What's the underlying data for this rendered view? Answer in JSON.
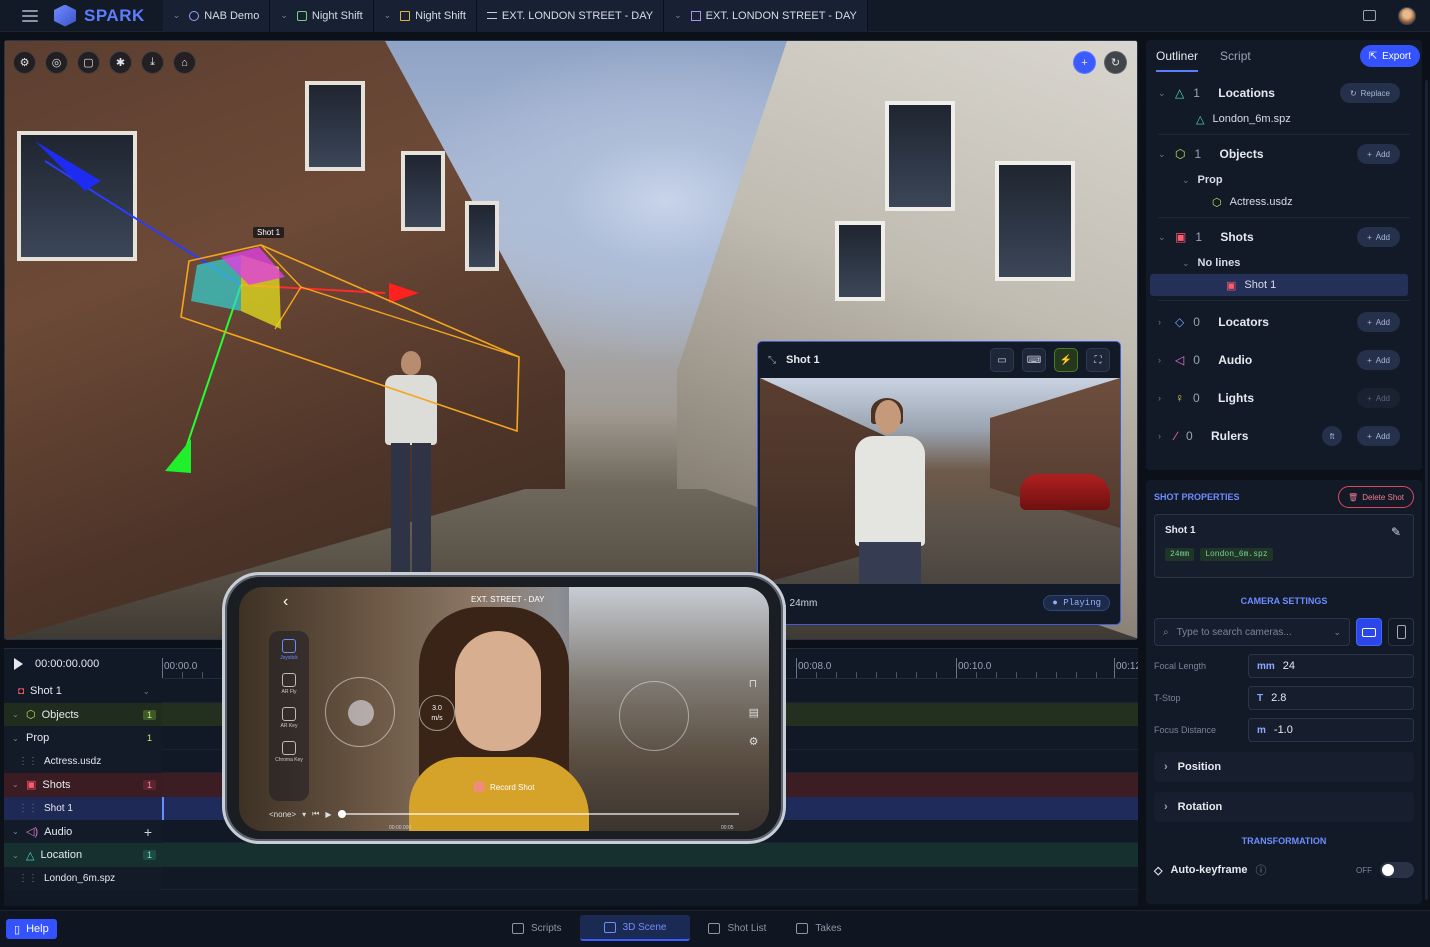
{
  "app": {
    "name": "SPARK"
  },
  "breadcrumbs": [
    {
      "label": "NAB Demo",
      "icon": "users-icon"
    },
    {
      "label": "Night Shift",
      "icon": "film-icon"
    },
    {
      "label": "Night Shift",
      "icon": "document-icon"
    },
    {
      "label": "EXT. LONDON STREET - DAY",
      "icon": "lines-icon"
    },
    {
      "label": "EXT. LONDON STREET - DAY",
      "icon": "grid-icon"
    }
  ],
  "viewport": {
    "shot_tag": "Shot 1",
    "tools": [
      "settings-icon",
      "compass-icon",
      "frame-icon",
      "bug-icon",
      "download-icon",
      "home-icon"
    ]
  },
  "shot_preview": {
    "title": "Shot 1",
    "lens_text": ", 24mm",
    "status": "Playing"
  },
  "phone": {
    "scene_title": "EXT. STREET - DAY",
    "joystick_label": "Joystick",
    "ar_fly_label": "AR Fly",
    "ar_key_label": "AR Key",
    "chroma_label": "Chroma Key",
    "speed_value": "3.0",
    "speed_unit": "m/s",
    "record_label": "Record Shot",
    "none_label": "<none>",
    "start_time": "00:00.000",
    "end_time": "00:05"
  },
  "timeline": {
    "time": "00:00:00.000",
    "shot_select": "Shot 1",
    "ruler": [
      "00:00.0",
      "00:08.0",
      "00:10.0",
      "00:12"
    ],
    "rows": [
      {
        "label": "Objects",
        "count": "1"
      },
      {
        "label": "Prop",
        "count": "1"
      },
      {
        "label": "Actress.usdz"
      },
      {
        "label": "Shots",
        "count": "1"
      },
      {
        "label": "Shot 1"
      },
      {
        "label": "Audio",
        "add": "+"
      },
      {
        "label": "Location",
        "count": "1"
      },
      {
        "label": "London_6m.spz"
      }
    ]
  },
  "outliner": {
    "tabs": [
      "Outliner",
      "Script"
    ],
    "export_label": "Export",
    "locations": {
      "count": "1",
      "label": "Locations",
      "action": "Replace",
      "item": "London_6m.spz"
    },
    "objects": {
      "count": "1",
      "label": "Objects",
      "action": "Add",
      "group": "Prop",
      "item": "Actress.usdz"
    },
    "shots": {
      "count": "1",
      "label": "Shots",
      "action": "Add",
      "group": "No lines",
      "item": "Shot 1"
    },
    "locators": {
      "count": "0",
      "label": "Locators",
      "action": "Add"
    },
    "audio": {
      "count": "0",
      "label": "Audio",
      "action": "Add"
    },
    "lights": {
      "count": "0",
      "label": "Lights",
      "action": "Add"
    },
    "rulers": {
      "count": "0",
      "label": "Rulers",
      "action": "Add",
      "unit": "ft"
    }
  },
  "shot_properties": {
    "title": "SHOT PROPERTIES",
    "delete_label": "Delete Shot",
    "shot_name": "Shot 1",
    "chips": [
      "24mm",
      "London_6m.spz"
    ],
    "camera_title": "CAMERA SETTINGS",
    "search_placeholder": "Type to search cameras...",
    "focal_label": "Focal Length",
    "focal_unit": "mm",
    "focal_value": "24",
    "tstop_label": "T-Stop",
    "tstop_unit": "T",
    "tstop_value": "2.8",
    "focus_label": "Focus Distance",
    "focus_unit": "m",
    "focus_value": "-1.0",
    "position_label": "Position",
    "rotation_label": "Rotation",
    "transform_title": "TRANSFORMATION",
    "autokey_label": "Auto-keyframe",
    "autokey_state": "OFF"
  },
  "bottom": {
    "help_label": "Help",
    "nav": [
      "Scripts",
      "3D Scene",
      "Shot List",
      "Takes"
    ],
    "active_nav": "3D Scene"
  },
  "colors": {
    "accent": "#3453ff",
    "brand": "#5d7dff",
    "danger": "#e0475e"
  }
}
